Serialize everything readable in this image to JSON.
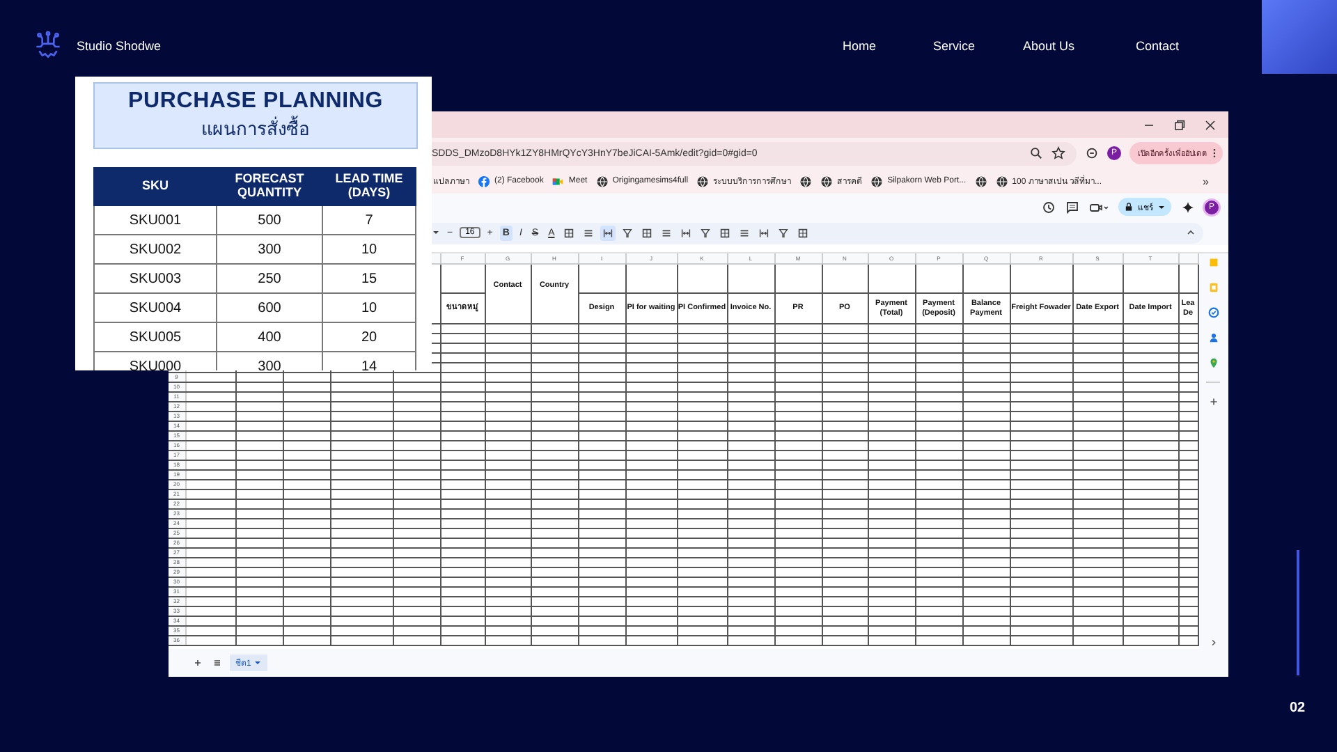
{
  "brand": {
    "name": "Studio Shodwe"
  },
  "nav": [
    {
      "label": "Home"
    },
    {
      "label": "Service"
    },
    {
      "label": "About Us"
    },
    {
      "label": "Contact"
    }
  ],
  "purchase_card": {
    "title": "PURCHASE PLANNING",
    "subtitle": "แผนการสั่งซื้อ",
    "columns": [
      "SKU",
      "FORECAST QUANTITY",
      "LEAD TIME (DAYS)"
    ],
    "rows": [
      [
        "SKU001",
        "500",
        "7"
      ],
      [
        "SKU002",
        "300",
        "10"
      ],
      [
        "SKU003",
        "250",
        "15"
      ],
      [
        "SKU004",
        "600",
        "10"
      ],
      [
        "SKU005",
        "400",
        "20"
      ],
      [
        "SKU000",
        "300",
        "14"
      ]
    ]
  },
  "browser": {
    "url": "SDDS_DMzoD8HYk1ZY8HMrQYcY3HnY7beJiCAI-5Amk/edit?gid=0#gid=0",
    "avatar": "P",
    "update_button": "เปิดอีกครั้งเพื่ออัปเดต",
    "bookmarks": [
      {
        "kind": "none",
        "label": "แปลภาษา"
      },
      {
        "kind": "facebook",
        "label": "(2) Facebook"
      },
      {
        "kind": "meet",
        "label": "Meet"
      },
      {
        "kind": "globe",
        "label": "Origingamesims4full"
      },
      {
        "kind": "globe",
        "label": "ระบบบริการการศึกษา"
      },
      {
        "kind": "globe"
      },
      {
        "kind": "globe",
        "label": "สารคดี"
      },
      {
        "kind": "globe",
        "label": "Silpakorn Web Port..."
      },
      {
        "kind": "globe"
      },
      {
        "kind": "globe",
        "label": "100 ภาษาสเปน วลีที่มา..."
      }
    ],
    "more_bookmarks": "»",
    "sheets_toolbar": {
      "share": "แชร์",
      "avatar": "P"
    },
    "format_toolbar": {
      "font_size": "16",
      "text_buttons": [
        {
          "label": "−",
          "selected": false
        },
        {
          "label": "+",
          "selected": false
        },
        {
          "label": "B",
          "selected": true
        },
        {
          "label": "I",
          "selected": false
        },
        {
          "label": "S",
          "selected": false
        },
        {
          "label": "A",
          "selected": false
        }
      ],
      "icon_buttons": [
        {
          "selected": false
        },
        {
          "selected": false
        },
        {
          "selected": true
        },
        {
          "selected": false
        },
        {
          "selected": false
        },
        {
          "selected": false
        },
        {
          "selected": false
        },
        {
          "selected": false
        },
        {
          "selected": false
        },
        {
          "selected": false
        },
        {
          "selected": false
        },
        {
          "selected": false
        },
        {
          "selected": false
        }
      ]
    },
    "sheet": {
      "columns": [
        {
          "letter": "F",
          "header": "ขนาดหมู่",
          "merged": false
        },
        {
          "letter": "G",
          "header": "Contact",
          "merged": true
        },
        {
          "letter": "H",
          "header": "Country",
          "merged": true
        },
        {
          "letter": "I",
          "header": "Design",
          "merged": false
        },
        {
          "letter": "J",
          "header": "PI for waiting",
          "merged": false
        },
        {
          "letter": "K",
          "header": "PI Confirmed",
          "merged": false
        },
        {
          "letter": "L",
          "header": "Invoice No.",
          "merged": false
        },
        {
          "letter": "M",
          "header": "PR",
          "merged": false
        },
        {
          "letter": "N",
          "header": "PO",
          "merged": false
        },
        {
          "letter": "O",
          "header": "Payment (Total)",
          "merged": false
        },
        {
          "letter": "P",
          "header": "Payment (Deposit)",
          "merged": false
        },
        {
          "letter": "Q",
          "header": "Balance Payment",
          "merged": false
        },
        {
          "letter": "R",
          "header": "Freight Fowader",
          "merged": false
        },
        {
          "letter": "S",
          "header": "Date Export",
          "merged": false
        },
        {
          "letter": "T",
          "header": "Date Import",
          "merged": false
        },
        {
          "header": "Lea De",
          "merged": false
        }
      ],
      "row_numbers": [
        "9",
        "10",
        "11",
        "12",
        "13",
        "14",
        "15",
        "16",
        "17",
        "18",
        "19",
        "20",
        "21",
        "22",
        "23",
        "24",
        "25",
        "26",
        "27",
        "28",
        "29",
        "30",
        "31",
        "32",
        "33",
        "34",
        "35",
        "36"
      ]
    },
    "sheet_tabs": [
      {
        "label": "ชีต1",
        "selected": true
      }
    ]
  },
  "page_number": "02"
}
